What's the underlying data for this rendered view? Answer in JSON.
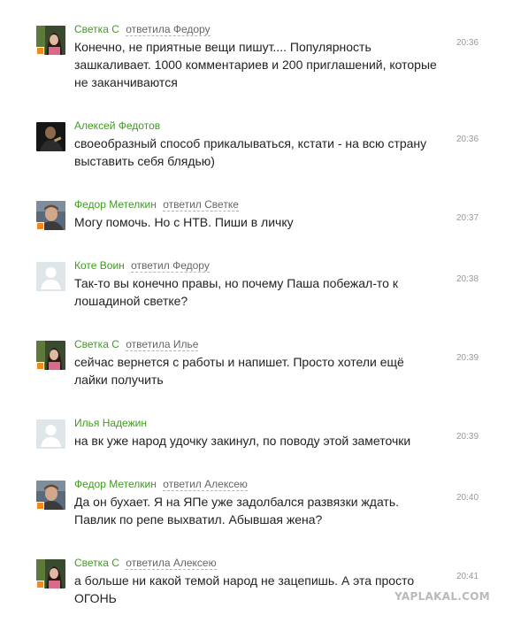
{
  "comments": [
    {
      "author": "Светка С",
      "action": "ответила Федору",
      "text": "Конечно, не приятные вещи пишут.... Популярность зашкаливает. 1000 комментариев и 200 приглашений, которые не заканчиваются",
      "time": "20:36"
    },
    {
      "author": "Алексей Федотов",
      "action": "",
      "text": "своеобразный способ прикалываться, кстати - на всю страну выставить себя блядью)",
      "time": "20:36"
    },
    {
      "author": "Федор Метелкин",
      "action": "ответил Светке",
      "text": "Могу помочь. Но с НТВ. Пиши в личку",
      "time": "20:37"
    },
    {
      "author": "Коте Воин",
      "action": "ответил Федору",
      "text": "Так-то вы конечно правы, но почему Паша побежал-то к лошадиной светке?",
      "time": "20:38"
    },
    {
      "author": "Светка С",
      "action": "ответила Илье",
      "text": "сейчас вернется с работы и напишет. Просто хотели ещё лайки получить",
      "time": "20:39"
    },
    {
      "author": "Илья Надежин",
      "action": "",
      "text": "на вк уже народ удочку закинул, по поводу этой заметочки",
      "time": "20:39"
    },
    {
      "author": "Федор Метелкин",
      "action": "ответил Алексею",
      "text": "Да он бухает. Я на ЯПе уже задолбался развязки ждать. Павлик по репе выхватил. Абывшая жена?",
      "time": "20:40"
    },
    {
      "author": "Светка С",
      "action": "ответила Алексею",
      "text": "а больше ни какой темой народ не зацепишь. А эта просто ОГОНЬ",
      "time": "20:41"
    }
  ],
  "watermark": "YAPLAKAL.COM",
  "colors": {
    "author": "#3d9c1e",
    "online_marker": "#f08a1c"
  }
}
